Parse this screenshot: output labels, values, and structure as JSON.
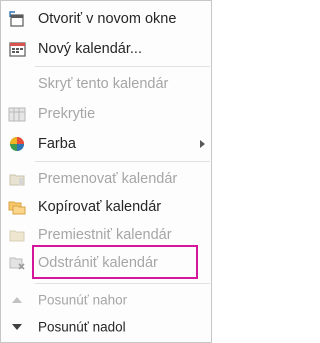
{
  "menu": {
    "items": [
      {
        "id": "open-new-window",
        "label": "Otvoriť v novom okne",
        "enabled": true,
        "icon": "new-window-icon"
      },
      {
        "id": "new-calendar",
        "label": "Nový kalendár...",
        "enabled": true,
        "icon": "calendar-icon"
      },
      {
        "id": "hide-calendar",
        "label": "Skryť tento kalendár",
        "enabled": false,
        "icon": ""
      },
      {
        "id": "overlay",
        "label": "Prekrytie",
        "enabled": false,
        "icon": "overlay-icon"
      },
      {
        "id": "color",
        "label": "Farba",
        "enabled": true,
        "icon": "color-palette-icon",
        "submenu": true
      },
      {
        "id": "rename-calendar",
        "label": "Premenovať kalendár",
        "enabled": false,
        "icon": "rename-icon"
      },
      {
        "id": "copy-calendar",
        "label": "Kopírovať kalendár",
        "enabled": true,
        "icon": "copy-folder-icon"
      },
      {
        "id": "move-calendar",
        "label": "Premiestniť kalendár",
        "enabled": false,
        "icon": "move-folder-icon"
      },
      {
        "id": "delete-calendar",
        "label": "Odstrániť kalendár",
        "enabled": false,
        "icon": "delete-icon"
      },
      {
        "id": "move-up",
        "label": "Posunúť nahor",
        "enabled": false,
        "icon": "arrow-up-icon"
      },
      {
        "id": "move-down",
        "label": "Posunúť nadol",
        "enabled": true,
        "icon": "arrow-down-icon"
      }
    ]
  },
  "colors": {
    "highlight_border": "#d6169a",
    "text_enabled": "#262626",
    "text_disabled": "#a6a6a6"
  }
}
